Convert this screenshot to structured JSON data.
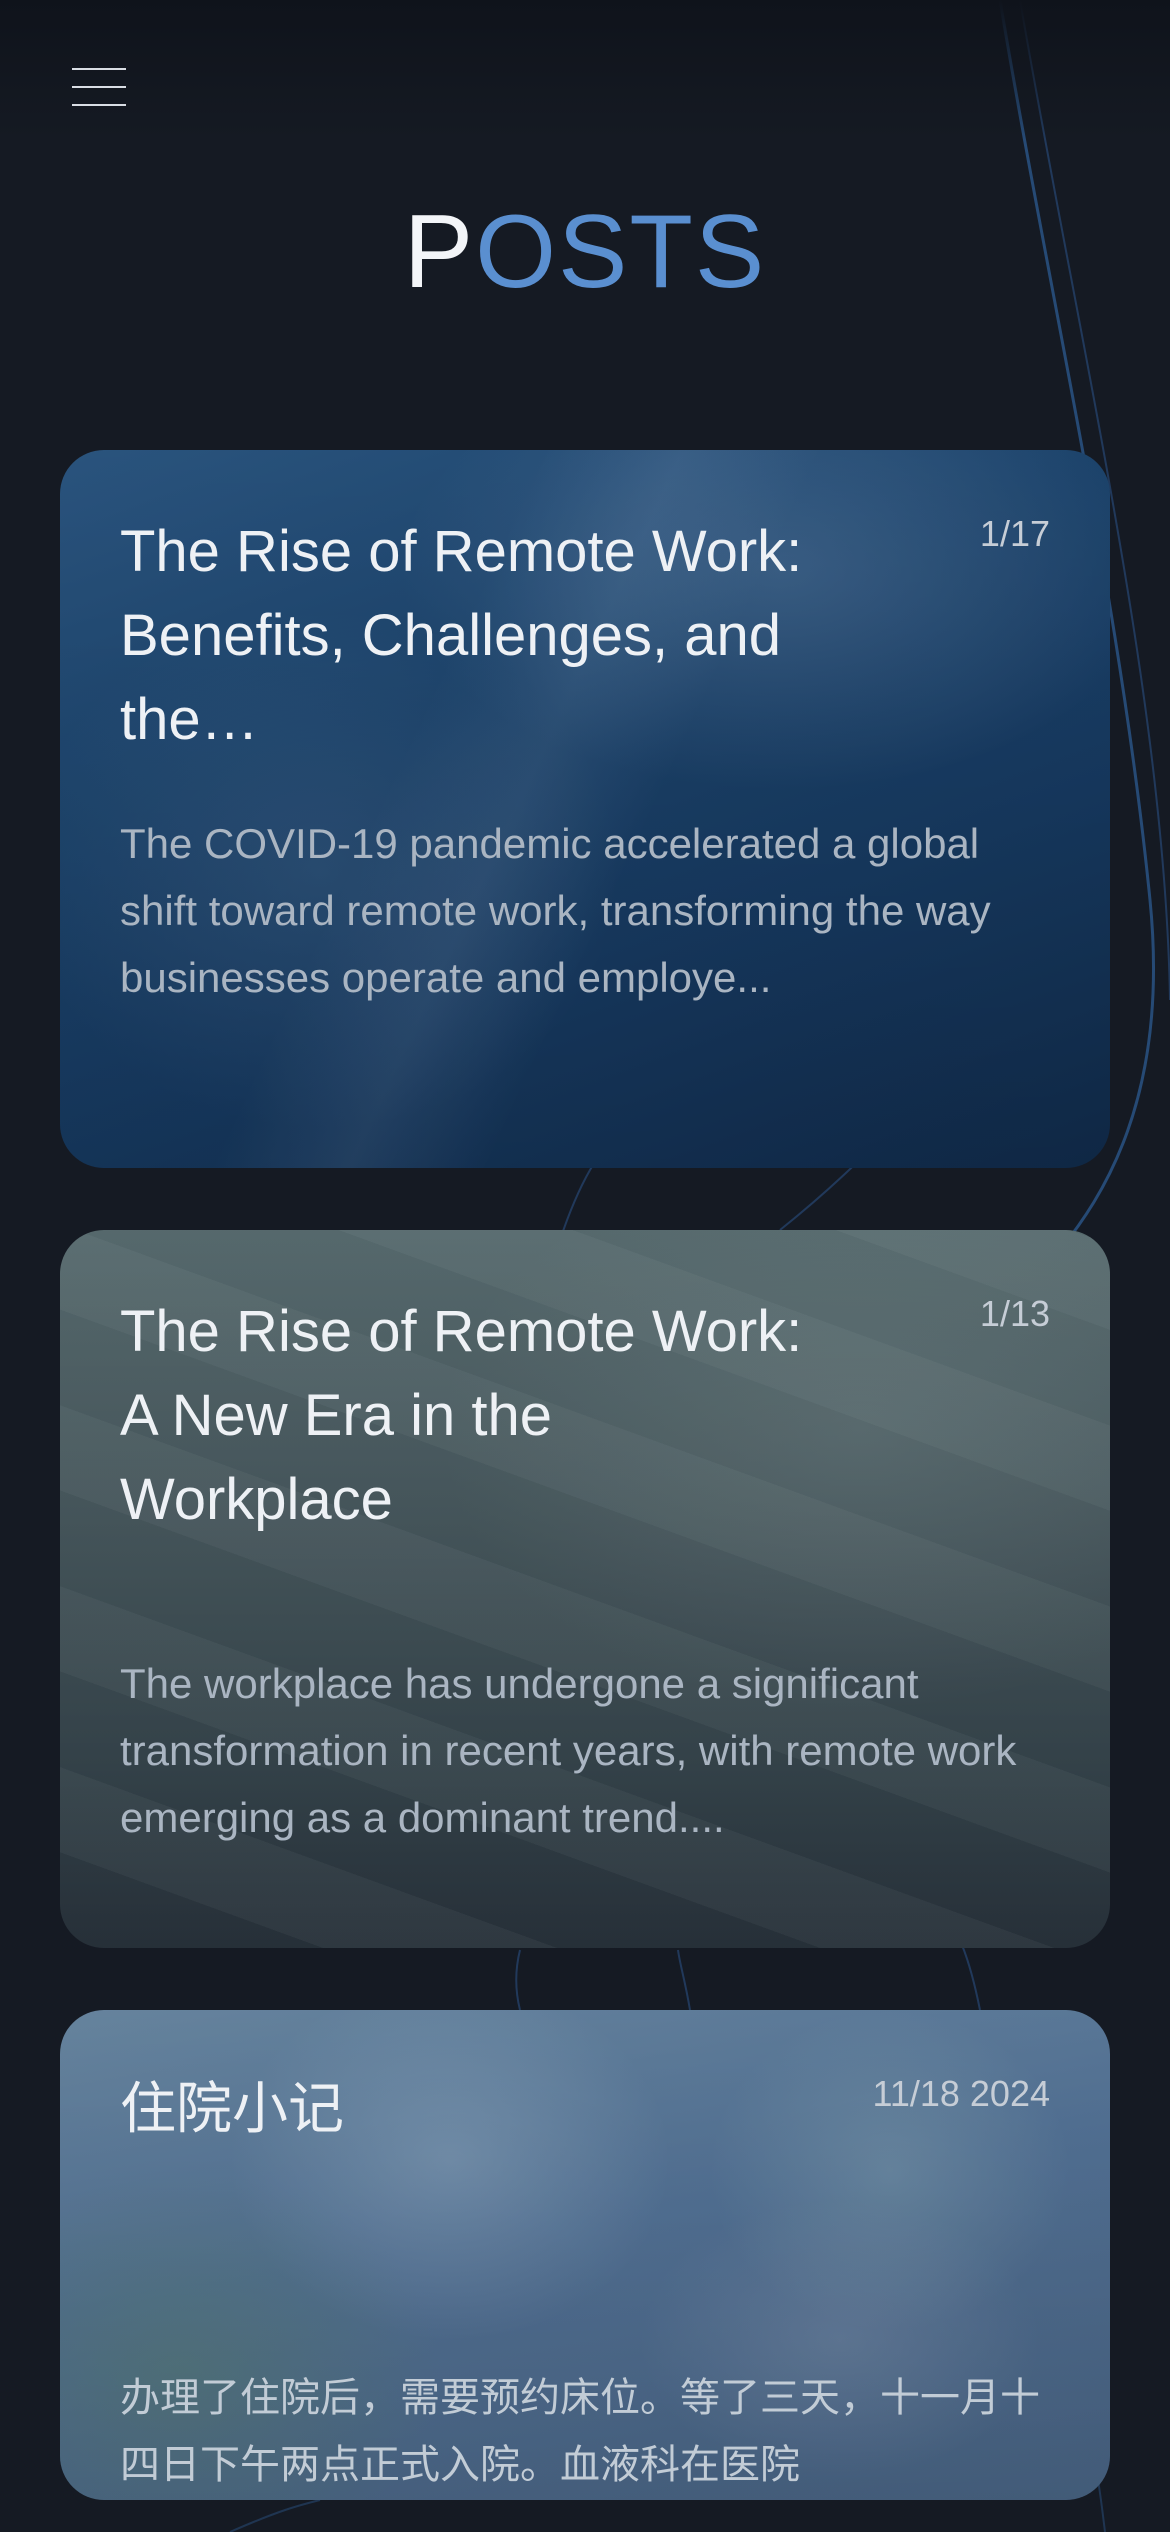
{
  "header": {
    "menu_icon": "hamburger-menu-icon",
    "title_first": "P",
    "title_rest": "OSTS"
  },
  "colors": {
    "background": "#151a23",
    "accent": "#5a8fd0",
    "title_primary": "#f3f5f8"
  },
  "posts": [
    {
      "title": "The Rise of Remote Work: Benefits, Challenges, and the…",
      "date": "1/17",
      "excerpt": "The COVID-19 pandemic accelerated a global shift toward remote work, transforming the way businesses operate and employe..."
    },
    {
      "title": "The Rise of Remote Work: A New Era in the Workplace",
      "date": "1/13",
      "excerpt": "The workplace has undergone a significant transformation in recent years, with remote work emerging as a dominant trend...."
    },
    {
      "title": "住院小记",
      "date": "11/18 2024",
      "excerpt": "办理了住院后，需要预约床位。等了三天，十一月十四日下午两点正式入院。血液科在医院"
    }
  ]
}
